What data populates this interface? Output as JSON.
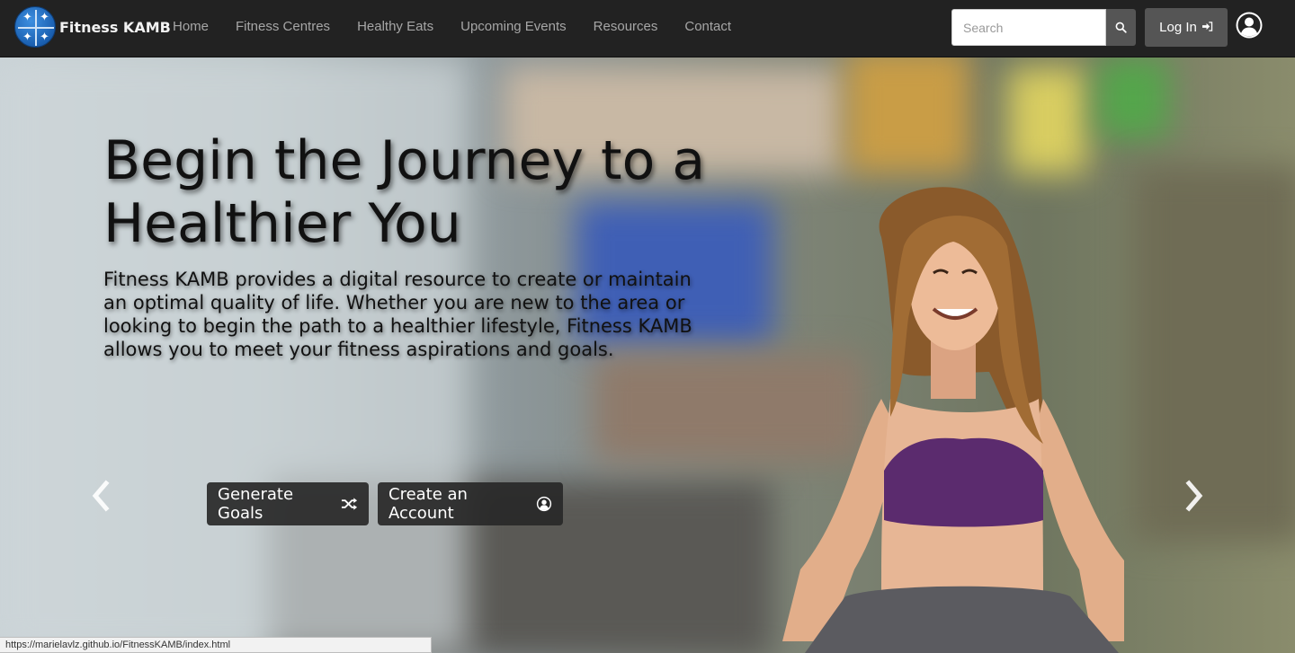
{
  "brand": {
    "name": "Fitness KAMB"
  },
  "nav": {
    "items": [
      {
        "label": "Home"
      },
      {
        "label": "Fitness Centres"
      },
      {
        "label": "Healthy Eats"
      },
      {
        "label": "Upcoming Events"
      },
      {
        "label": "Resources"
      },
      {
        "label": "Contact"
      }
    ]
  },
  "search": {
    "placeholder": "Search",
    "value": ""
  },
  "auth": {
    "login_label": "Log In"
  },
  "hero": {
    "headline": "Begin the Journey to a Healthier You",
    "lead": "Fitness KAMB provides a digital resource to create or maintain an optimal quality of life. Whether you are new to the area or looking to begin the path to a healthier lifestyle, Fitness KAMB allows you to meet your fitness aspirations and goals.",
    "buttons": {
      "goals_label": "Generate Goals",
      "account_label": "Create an Account"
    }
  },
  "status_bar": {
    "url": "https://marielavlz.github.io/FitnessKAMB/index.html"
  },
  "colors": {
    "navbar": "#222222",
    "nav_link": "#a6a6a6",
    "button_dark": "#555555",
    "hero_button": "#282828"
  },
  "icons": [
    "logo",
    "search-icon",
    "login-icon",
    "user-icon",
    "shuffle-icon",
    "user-circle-icon",
    "chevron-left-icon",
    "chevron-right-icon"
  ]
}
